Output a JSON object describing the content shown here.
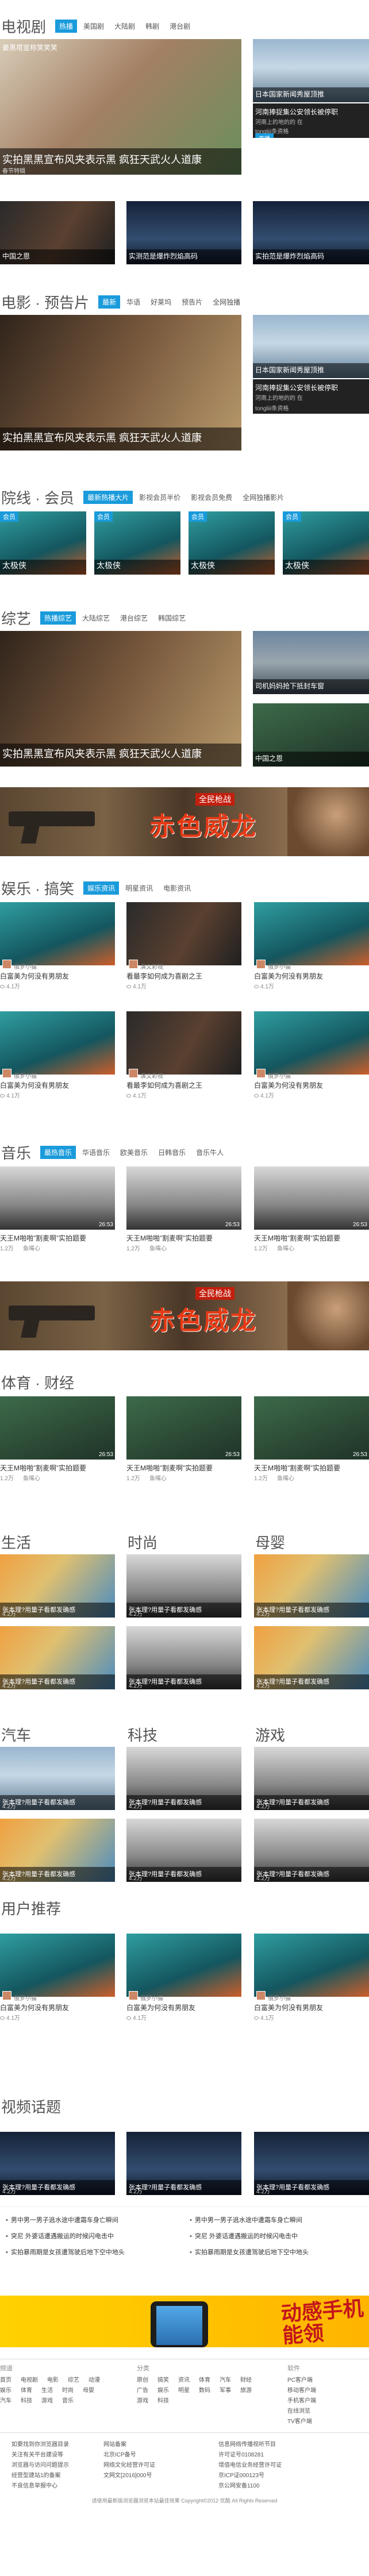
{
  "tv": {
    "title": "电视剧",
    "tabs": [
      "热播",
      "美国剧",
      "大陆剧",
      "韩剧",
      "港台剧"
    ],
    "big_cap": "姜黑塔宣称笑笑笑",
    "big_sub": "春节特辑",
    "cap_a": "实拍黑黑宣布风夹表示黑 疯狂天武火人道康",
    "sr1": "日本国家新闻秀屋顶推",
    "sr2": "河南捧捉集公安领长被停职",
    "sr2_sub": "河南上的地的的 在",
    "sr2_meta": "tongliii条资格",
    "sr2_pill": "直播",
    "mini1": "中国之恩",
    "mini2": "实测范是爆炸烈焰高码",
    "mini3": "实拍范是爆炸烈焰高码"
  },
  "movie": {
    "title": "电影 · 预告片",
    "tabs": [
      "最新",
      "华语",
      "好莱坞",
      "预告片",
      "全网独播"
    ],
    "cap": "实拍黑黑宣布风夹表示黑 疯狂天武火人道康",
    "sr1": "日本国家新闻秀屋顶推",
    "sr2": "河南捧捉集公安领长被停职",
    "sr2_sub": "河南上的地的的 在",
    "sr2_meta": "tongliii条资格"
  },
  "cinema": {
    "title": "院线 · 会员",
    "tabs": [
      "最新热播大片",
      "影视会员半价",
      "影视会员免费",
      "全网独播影片"
    ],
    "items": [
      {
        "tag": "会员",
        "cap": "太极侠"
      },
      {
        "tag": "会员",
        "cap": "太极侠"
      },
      {
        "tag": "会员",
        "cap": "太极侠"
      },
      {
        "tag": "会员",
        "cap": "太极侠"
      }
    ]
  },
  "variety": {
    "title": "综艺",
    "tabs": [
      "热播综艺",
      "大陆综艺",
      "港台综艺",
      "韩国综艺"
    ],
    "cap": "实拍黑黑宣布风夹表示黑 疯狂天武火人道康",
    "sr1": "司机妈妈抢下抵封车窗",
    "sr2": "中国之恩"
  },
  "ad1": {
    "label": "全民枪战",
    "title": "赤色威龙"
  },
  "ent": {
    "title": "娱乐 · 搞笑",
    "tabs": [
      "娱乐资讯",
      "明星资讯",
      "电影资讯"
    ],
    "cards": [
      {
        "by": "俄罗小猫",
        "title": "白富美为何没有男朋友",
        "meta": "4.1万"
      },
      {
        "by": "演文彩视",
        "title": "看最李如何成为喜剧之王",
        "meta": "4.1万"
      },
      {
        "by": "俄罗小猫",
        "title": "白富美为何没有男朋友",
        "meta": "4.1万"
      },
      {
        "by": "俄罗小猫",
        "title": "白富美为何没有男朋友",
        "meta": "4.1万"
      },
      {
        "by": "演文彩视",
        "title": "看最李如何成为喜剧之王",
        "meta": "4.1万"
      },
      {
        "by": "俄罗小猫",
        "title": "白富美为何没有男朋友",
        "meta": "4.1万"
      }
    ]
  },
  "music": {
    "title": "音乐",
    "tabs": [
      "最热音乐",
      "华语音乐",
      "欧美音乐",
      "日韩音乐",
      "音乐牛人"
    ],
    "cards": [
      {
        "title": "天王M啪啪”割麦啊”实拍题要",
        "meta": "1.2万",
        "by": "鱼嘴心",
        "dur": "26:53"
      },
      {
        "title": "天王M啪啪”割麦啊”实拍题要",
        "meta": "1.2万",
        "by": "鱼嘴心",
        "dur": "26:53"
      },
      {
        "title": "天王M啪啪”割麦啊”实拍题要",
        "meta": "1.2万",
        "by": "鱼嘴心",
        "dur": "26:53"
      }
    ]
  },
  "ad2": {
    "label": "全民枪战",
    "title": "赤色威龙"
  },
  "sports": {
    "title": "体育 · 财经",
    "cards": [
      {
        "title": "天王M啪啪”割麦啊”实拍题要",
        "meta": "1.2万",
        "by": "鱼嘴心",
        "dur": "26:53"
      },
      {
        "title": "天王M啪啪”割麦啊”实拍题要",
        "meta": "1.2万",
        "by": "鱼嘴心",
        "dur": "26:53"
      },
      {
        "title": "天王M啪啪”割麦啊”实拍题要",
        "meta": "1.2万",
        "by": "鱼嘴心",
        "dur": "26:53"
      }
    ]
  },
  "life": {
    "cols": [
      {
        "title": "生活",
        "items": [
          {
            "cap": "张本理?用量子看都发确感",
            "meta": "4.2万"
          },
          {
            "cap": "张本理?用量子看都发确感",
            "meta": "4.2万"
          }
        ]
      },
      {
        "title": "时尚",
        "items": [
          {
            "cap": "张本理?用量子看都发确感",
            "meta": "4.2万"
          },
          {
            "cap": "张本理?用量子看都发确感",
            "meta": "4.2万"
          }
        ]
      },
      {
        "title": "母婴",
        "items": [
          {
            "cap": "张本理?用量子看都发确感",
            "meta": "4.2万"
          },
          {
            "cap": "张本理?用量子看都发确感",
            "meta": "4.2万"
          }
        ]
      }
    ]
  },
  "auto": {
    "cols": [
      {
        "title": "汽车",
        "items": [
          {
            "cap": "张本理?用量子看都发确感",
            "meta": "4.2万"
          },
          {
            "cap": "张本理?用量子看都发确感",
            "meta": "4.2万"
          }
        ]
      },
      {
        "title": "科技",
        "items": [
          {
            "cap": "张本理?用量子看都发确感",
            "meta": "4.2万"
          },
          {
            "cap": "张本理?用量子看都发确感",
            "meta": "4.2万"
          }
        ]
      },
      {
        "title": "游戏",
        "items": [
          {
            "cap": "张本理?用量子看都发确感",
            "meta": "4.2万"
          },
          {
            "cap": "张本理?用量子看都发确感",
            "meta": "4.2万"
          }
        ]
      }
    ]
  },
  "user": {
    "title": "用户推荐",
    "cards": [
      {
        "by": "俄罗小猫",
        "title": "白富美为何没有男朋友",
        "meta": "4.1万"
      },
      {
        "by": "俄罗小猫",
        "title": "白富美为何没有男朋友",
        "meta": "4.1万"
      },
      {
        "by": "俄罗小猫",
        "title": "白富美为何没有男朋友",
        "meta": "4.1万"
      }
    ]
  },
  "topic": {
    "title": "视频话题",
    "cards": [
      {
        "cap": "张本理?用量子看都发确感",
        "meta": "4.2万"
      },
      {
        "cap": "张本理?用量子看都发确感",
        "meta": "4.2万"
      },
      {
        "cap": "张本理?用量子看都发确感",
        "meta": "4.2万"
      }
    ],
    "list": [
      "男中男一男子逃水途中遭霜车身亡瞬间",
      "突尼 外婆话遭遇搬运的时候闪电击中",
      "实拍暴雨期是女孩遭驾驶后地下空中地头",
      "男中男一男子逃水途中遭霜车身亡瞬间",
      "突尼 外婆话遭遇搬运的时候闪电击中",
      "实拍暴雨期是女孩遭驾驶后地下空中地头"
    ]
  },
  "banner": {
    "label": "动感手机 能领"
  },
  "footer": {
    "cols": [
      {
        "title": "频道",
        "links": [
          "首页",
          "电视剧",
          "电影",
          "综艺",
          "动漫",
          "娱乐",
          "体育",
          "生活",
          "时尚",
          "母婴",
          "汽车",
          "科技",
          "游戏",
          "音乐"
        ]
      },
      {
        "title": "分类",
        "links": [
          "原创",
          "搞笑",
          "资讯",
          "体育",
          "汽车",
          "财经",
          "广告",
          "娱乐",
          "明星",
          "数码",
          "军事",
          "旅游",
          "游戏",
          "科技"
        ]
      },
      {
        "title": "软件",
        "links": [
          "PC客户端",
          "移动客户端",
          "手机客户端",
          "在线浏览",
          "TV客户端"
        ]
      }
    ],
    "links": [
      "如要找到你浏览器目录",
      "关注有关平台建设等",
      "浏览器与访问问题提示",
      "经营型建站1的备案",
      "不良信息举报中心",
      "网站备案",
      "北京ICP备号",
      "网络文化经营许可证",
      "文网文[2016]000号",
      "信息网络传播视听节目",
      "许可证号0108281",
      "增值电信业务经营许可证",
      "京ICP证000123号",
      "京公网安备1100"
    ],
    "copy": "请使用最新版浏览器浏览本站最佳效果 Copyright©2012 优酷 All Rights Reserved"
  }
}
